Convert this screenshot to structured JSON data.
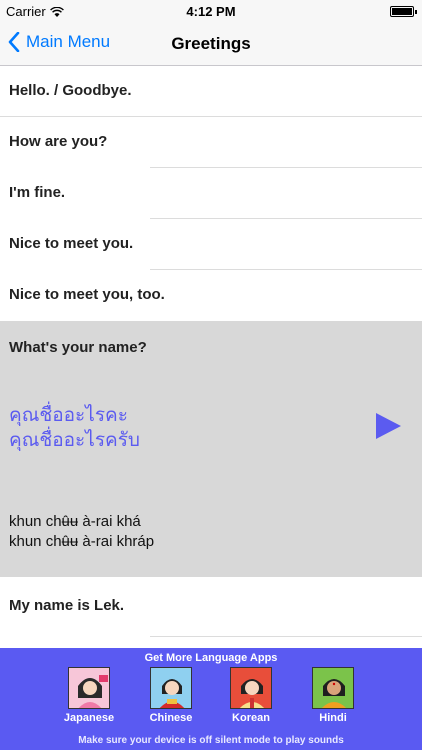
{
  "status": {
    "carrier": "Carrier",
    "time": "4:12 PM"
  },
  "nav": {
    "back_label": "Main Menu",
    "title": "Greetings"
  },
  "phrases": [
    {
      "en": "Hello. / Goodbye."
    },
    {
      "en": "How are you?"
    },
    {
      "en": "I'm fine."
    },
    {
      "en": "Nice to meet you."
    },
    {
      "en": "Nice to meet you, too."
    }
  ],
  "expanded": {
    "en": "What's your name?",
    "thai_female": "คุณชื่ออะไรคะ",
    "thai_male": "คุณชื่ออะไรครับ",
    "translit_female": "khun chʉ̂ʉ à-rai khá",
    "translit_male": "khun chʉ̂ʉ à-rai khráp"
  },
  "after": [
    {
      "en": "My name is Lek."
    }
  ],
  "ad": {
    "title": "Get More Language Apps",
    "apps": [
      {
        "label": "Japanese"
      },
      {
        "label": "Chinese"
      },
      {
        "label": "Korean"
      },
      {
        "label": "Hindi"
      }
    ],
    "footer": "Make sure your device is off silent mode to play sounds"
  },
  "colors": {
    "accent": "#007aff",
    "thai_text": "#5b5bf0",
    "play_icon": "#5b5bf0",
    "banner": "#5a5af2",
    "expanded_bg": "#d8d8d8"
  }
}
